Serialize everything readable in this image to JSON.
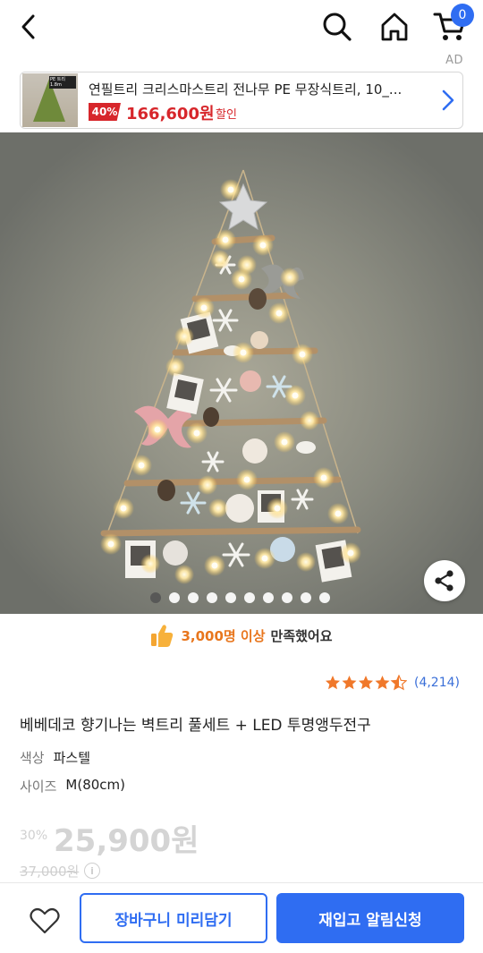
{
  "header": {
    "back_icon": "chevron-left-icon",
    "search_icon": "search-icon",
    "home_icon": "home-icon",
    "cart_icon": "cart-icon",
    "cart_count": "0",
    "accent_color": "#2f6df2"
  },
  "ad": {
    "label": "AD",
    "thumb_tag": "PE 트리 1.8m",
    "title": "연필트리 크리스마스트리 전나무 PE 무장식트리, 10_...",
    "discount": "40%",
    "price": "166,600원",
    "sale_label": "할인",
    "arrow_icon": "chevron-right-icon"
  },
  "gallery": {
    "image_count": 10,
    "active_index": 0,
    "share_icon": "share-icon"
  },
  "satisfaction": {
    "icon": "thumbs-up-icon",
    "highlight": "3,000명 이상",
    "rest": "만족했어요"
  },
  "rating": {
    "stars": 4.5,
    "count": "(4,214)",
    "star_color": "#f0782a"
  },
  "product": {
    "title": "베베데코 향기나는 벽트리 풀세트 + LED 투명앵두전구",
    "options": [
      {
        "label": "색상",
        "value": "파스텔"
      },
      {
        "label": "사이즈",
        "value": "M(80cm)"
      }
    ],
    "discount_pct": "30%",
    "price": "25,900원",
    "original_price": "37,000원"
  },
  "bottom": {
    "wish_icon": "heart-icon",
    "cart_button": "장바구니 미리담기",
    "notify_button": "재입고 알림신청"
  }
}
